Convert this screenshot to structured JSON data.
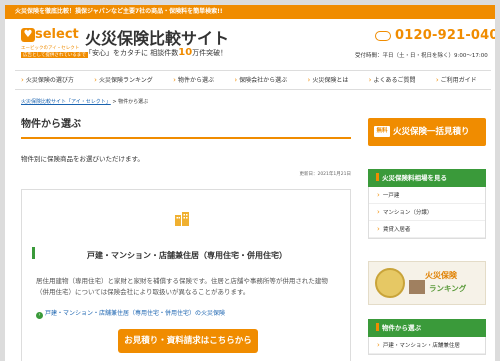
{
  "topbar": {
    "text": "火災保険を徹底比較！損保ジャパンなど主要7社の商品・保険料を簡単検索!!"
  },
  "logo": {
    "word": "select",
    "sub1": "エービックのアイ・セレクト",
    "sub2": "広告として提供されているまで"
  },
  "header": {
    "title": "火災保険比較サイト",
    "tagline_prefix": "「安心」をカタチに 相談件数",
    "tagline_number": "10",
    "tagline_suffix": "万件突破！",
    "phone": "0120-921-040",
    "hours": "受付時間：平日（土・日・祝日を除く）9:00〜17:00"
  },
  "nav": {
    "items": [
      "火災保険の選び方",
      "火災保険ランキング",
      "物件から選ぶ",
      "保険会社から選ぶ",
      "火災保険とは",
      "よくあるご質問",
      "ご利用ガイド"
    ]
  },
  "breadcrumb": {
    "home": "火災保険比較サイト「アイ・セレクト」",
    "sep": " > ",
    "current": "物件から選ぶ"
  },
  "main": {
    "heading": "物件から選ぶ",
    "intro": "物件別に保険商品をお選びいただけます。",
    "updated": "更新日：2021年1月21日",
    "card": {
      "title": "戸建・マンション・店舗兼住居（専用住宅・併用住宅）",
      "desc": "居住用建物（専用住宅）と家財と家財を補償する保険です。住居と店舗や事務所等が併用された建物（併用住宅）については保険会社により取扱いが異なることがあります。",
      "link": "戸建・マンション・店舗兼住居（専用住宅・併用住宅）の火災保険",
      "cta": "お見積り・資料請求はこちらから"
    }
  },
  "sidebar": {
    "cta_free": "無料",
    "cta_label": "火災保険一括見積り",
    "section1_title": "火災保険料相場を見る",
    "section1_items": [
      "一戸建",
      "マンション（分譲）",
      "賃貸入居者"
    ],
    "ranking_line1": "火災保険",
    "ranking_line2": "ランキング",
    "section2_title": "物件から選ぶ",
    "section2_items": [
      "戸建・マンション・店舗兼住居"
    ]
  },
  "colors": {
    "accent": "#f08c00",
    "green": "#3a9a3a",
    "link": "#1a63b0"
  }
}
